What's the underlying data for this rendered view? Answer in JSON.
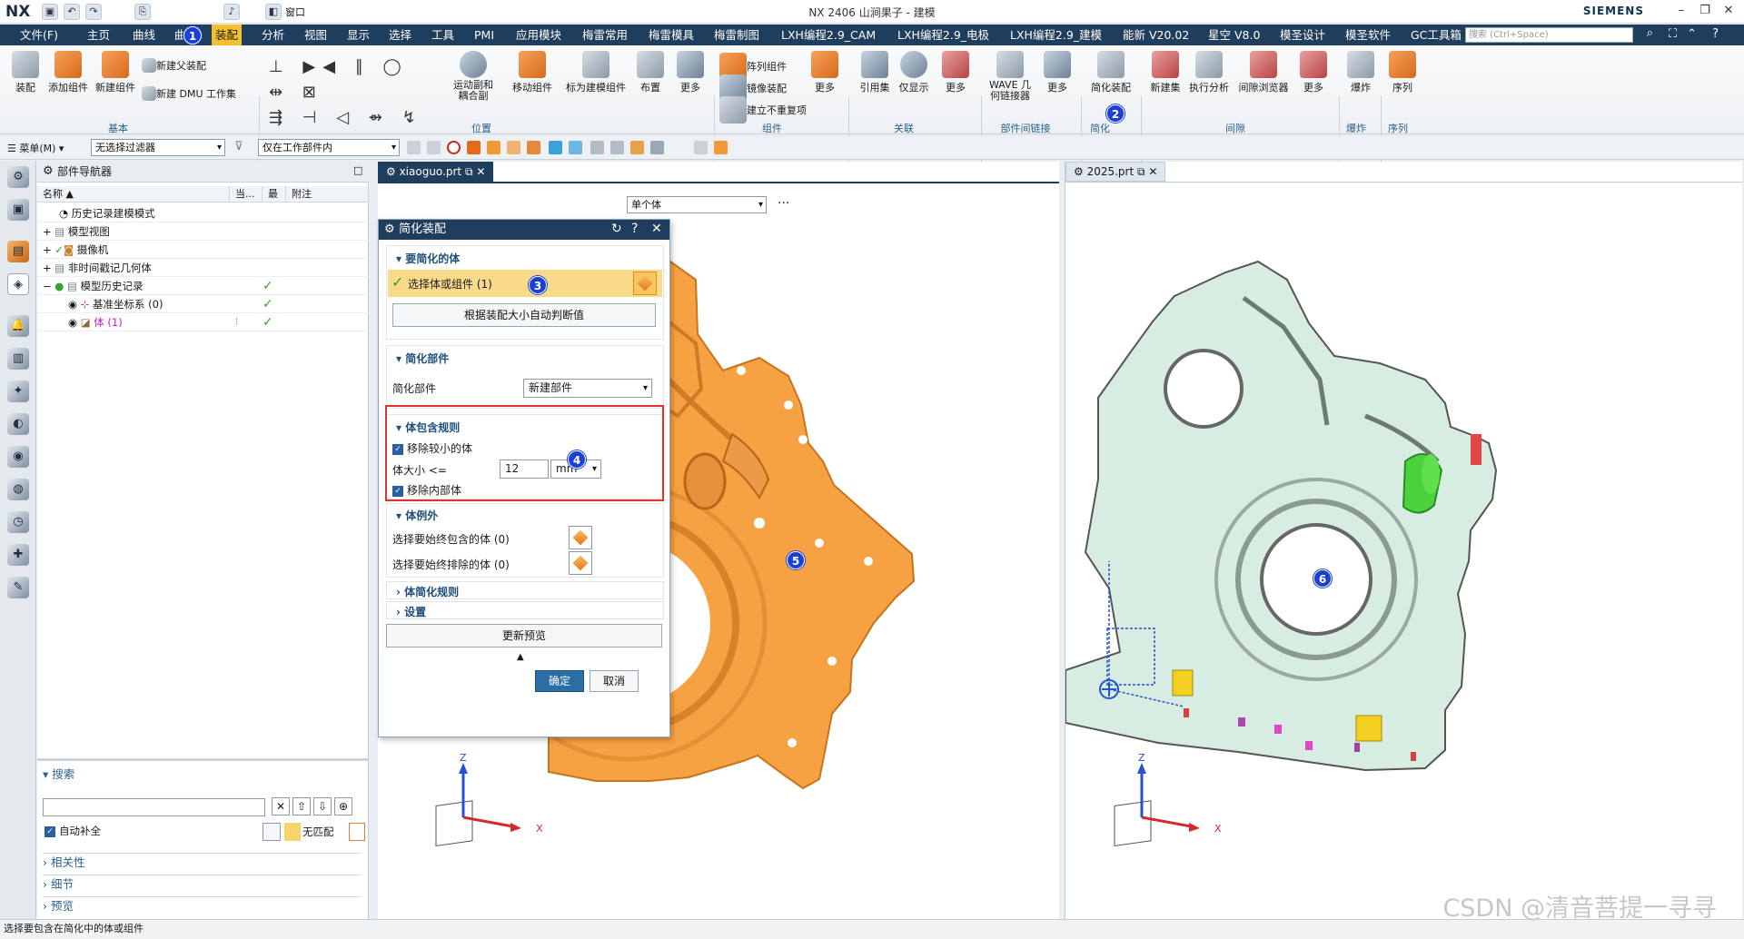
{
  "titlebar": {
    "logo": "NX",
    "title": "NX 2406 山涧果子 - 建模",
    "brand": "SIEMENS",
    "window_menu": "窗口"
  },
  "menubar": {
    "items": [
      "文件(F)",
      "主页",
      "曲线",
      "曲",
      "装配",
      "分析",
      "视图",
      "显示",
      "选择",
      "工具",
      "PMI",
      "应用模块",
      "梅雷常用",
      "梅雷模具",
      "梅雷制图",
      "LXH编程2.9_CAM",
      "LXH编程2.9_电极",
      "LXH编程2.9_建模",
      "能新 V20.02",
      "星空 V8.0",
      "模圣设计",
      "模圣软件",
      "GC工具箱"
    ],
    "active": "装配",
    "search_placeholder": "搜索 (Ctrl+Space)"
  },
  "ribbon": {
    "large": [
      {
        "label": "装配"
      },
      {
        "label": "添加组件"
      },
      {
        "label": "新建组件"
      },
      {
        "label": "运动副和\n耦合副"
      },
      {
        "label": "移动组件"
      },
      {
        "label": "标为建模组件"
      },
      {
        "label": "布置"
      },
      {
        "label": "更多"
      },
      {
        "label": "更多"
      },
      {
        "label": "引用集"
      },
      {
        "label": "仅显示"
      },
      {
        "label": "更多"
      },
      {
        "label": "WAVE 几\n何链接器"
      },
      {
        "label": "更多"
      },
      {
        "label": "简化装配"
      },
      {
        "label": "新建集"
      },
      {
        "label": "执行分析"
      },
      {
        "label": "间隙浏览器"
      },
      {
        "label": "更多"
      },
      {
        "label": "爆炸"
      },
      {
        "label": "序列"
      }
    ],
    "small": [
      "新建父装配",
      "新建 DMU 工作集",
      "阵列组件",
      "镜像装配",
      "建立不重复项"
    ],
    "groups": [
      "基本",
      "位置",
      "组件",
      "关联",
      "部件间链接",
      "简化",
      "间隙",
      "爆炸",
      "序列"
    ]
  },
  "toolbar2": {
    "menu": "菜单(M)",
    "filter": "无选择过滤器",
    "scope": "仅在工作部件内"
  },
  "navigator": {
    "title": "部件导航器",
    "columns": [
      "名称",
      "当...",
      "最",
      "附注"
    ],
    "rows": [
      {
        "label": "历史记录建模模式",
        "check": false
      },
      {
        "label": "模型视图",
        "check": false
      },
      {
        "label": "摄像机",
        "check": false
      },
      {
        "label": "非时间戳记几何体",
        "check": false
      },
      {
        "label": "模型历史记录",
        "check": true
      },
      {
        "label": "基准坐标系 (0)",
        "check": true
      },
      {
        "label": "体 (1)",
        "check": true
      }
    ],
    "search_title": "搜索",
    "autocomplete": "自动补全",
    "nomatch": "无匹配",
    "accordions": [
      "相关性",
      "细节",
      "预览"
    ]
  },
  "viewport1": {
    "tab": "xiaoguo.prt",
    "combo": "单个体",
    "dots": "···",
    "axis": {
      "z": "Z",
      "x": "X"
    }
  },
  "viewport2": {
    "tab": "2025.prt",
    "axis": {
      "z": "Z",
      "x": "X"
    }
  },
  "dialog": {
    "title": "简化装配",
    "sec1": {
      "title": "要简化的体",
      "select": "选择体或组件 (1)",
      "auto": "根据装配大小自动判断值"
    },
    "sec2": {
      "title": "简化部件",
      "label": "简化部件",
      "value": "新建部件"
    },
    "sec3": {
      "title": "体包含规则",
      "remove_small": "移除较小的体",
      "size_label": "体大小 <=",
      "size_value": "12",
      "unit": "mm",
      "remove_inner": "移除内部体"
    },
    "sec4": {
      "title": "体例外",
      "include": "选择要始终包含的体 (0)",
      "exclude": "选择要始终排除的体 (0)"
    },
    "sec5": {
      "title": "体简化规则"
    },
    "sec6": {
      "title": "设置"
    },
    "update": "更新预览",
    "ok": "确定",
    "cancel": "取消"
  },
  "badges": [
    "1",
    "2",
    "3",
    "4",
    "5",
    "6"
  ],
  "status": "选择要包含在简化中的体或组件",
  "watermark": "CSDN @清音菩提一寻寻",
  "colors": {
    "menubar": "#1f3d5c",
    "active_tab": "#f3c12f",
    "orange_part": "#f6a142",
    "green_part": "#d8ede1",
    "badge": "#1c3fd6",
    "highlight_box": "#e0332e"
  }
}
